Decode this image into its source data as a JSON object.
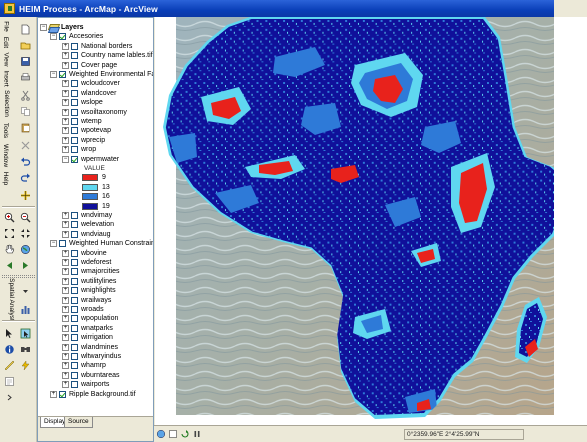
{
  "window": {
    "title": "HEIM Process - ArcMap - ArcView"
  },
  "menus": [
    {
      "label": "File"
    },
    {
      "label": "Edit"
    },
    {
      "label": "View"
    },
    {
      "label": "Insert"
    },
    {
      "label": "Selection"
    },
    {
      "label": "Tools"
    },
    {
      "label": "Window"
    },
    {
      "label": "Help"
    }
  ],
  "spatial_analyst": "Spatial Analyst",
  "toc": {
    "root": "Layers",
    "groups": [
      {
        "label": "Accesories",
        "checked": true,
        "expanded": true,
        "layers": [
          {
            "label": "National borders",
            "checked": false
          },
          {
            "label": "Country name lables.tif",
            "checked": false
          },
          {
            "label": "Cover page",
            "checked": false
          }
        ]
      },
      {
        "label": "Weighted Environmental Fa",
        "checked": true,
        "expanded": true,
        "layers": [
          {
            "label": "wcloudcover",
            "checked": false
          },
          {
            "label": "wlandcover",
            "checked": false
          },
          {
            "label": "wslope",
            "checked": false
          },
          {
            "label": "wsoiltaxonomy",
            "checked": false
          },
          {
            "label": "wtemp",
            "checked": false
          },
          {
            "label": "wpotevap",
            "checked": false
          },
          {
            "label": "wprecip",
            "checked": false
          },
          {
            "label": "wrop",
            "checked": false
          },
          {
            "label": "wpermwater",
            "checked": true,
            "expanded": true
          }
        ],
        "legend": {
          "header": "VALUE",
          "classes": [
            {
              "label": "9",
              "color": "#e8221c"
            },
            {
              "label": "13",
              "color": "#5fd7f0"
            },
            {
              "label": "16",
              "color": "#2e7ad8"
            },
            {
              "label": "19",
              "color": "#10109a"
            }
          ]
        },
        "after": [
          {
            "label": "wndvimay",
            "checked": false
          },
          {
            "label": "welevation",
            "checked": false
          },
          {
            "label": "wndviaug",
            "checked": false
          }
        ]
      },
      {
        "label": "Weighted Human Constraint",
        "checked": false,
        "expanded": true,
        "layers": [
          {
            "label": "wbovine",
            "checked": false
          },
          {
            "label": "wdeforest",
            "checked": false
          },
          {
            "label": "wmajorcities",
            "checked": false
          },
          {
            "label": "wutilitylines",
            "checked": false
          },
          {
            "label": "wnighlights",
            "checked": false
          },
          {
            "label": "wrailways",
            "checked": false
          },
          {
            "label": "wroads",
            "checked": false
          },
          {
            "label": "wpopulation",
            "checked": false
          },
          {
            "label": "wnatparks",
            "checked": false
          },
          {
            "label": "wirrigation",
            "checked": false
          },
          {
            "label": "wlandmines",
            "checked": false
          },
          {
            "label": "wltwaryindus",
            "checked": false
          },
          {
            "label": "whamrp",
            "checked": false
          },
          {
            "label": "wburntareas",
            "checked": false
          },
          {
            "label": "wairports",
            "checked": false
          }
        ]
      }
    ],
    "background": {
      "label": "Ripple Background.tif",
      "checked": true
    }
  },
  "tabs": {
    "display": "Display",
    "source": "Source"
  },
  "status": {
    "coordinates": "0°2359.96\"E  2°4'25.99\"N"
  },
  "colors": {
    "class_9": "#e8221c",
    "class_13": "#5fd7f0",
    "class_16": "#2e7ad8",
    "class_19": "#10109a",
    "water": "#8fa7b2",
    "titlebar": "#0a3fb8"
  }
}
